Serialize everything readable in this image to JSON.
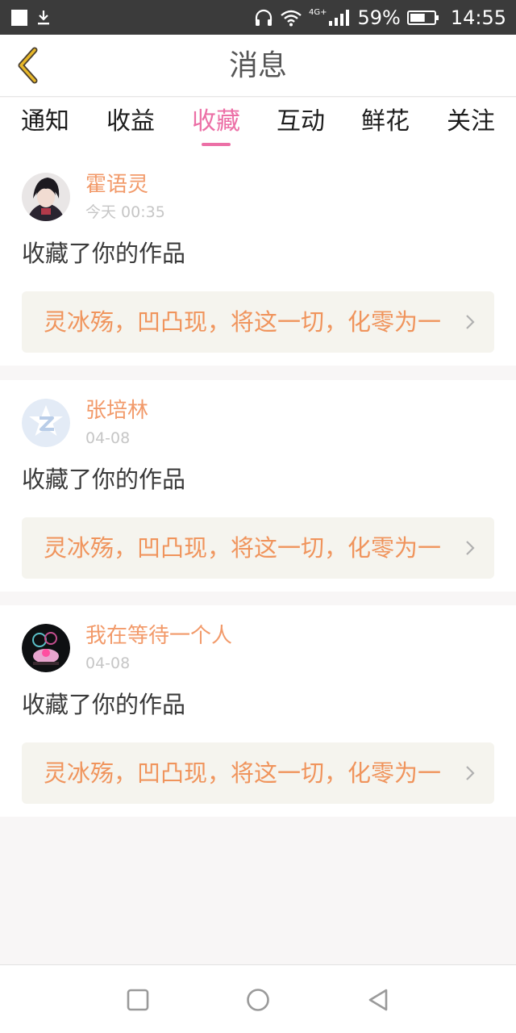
{
  "status_bar": {
    "network_type": "4G+",
    "battery_percent": "59%",
    "battery_level": 0.59,
    "time": "14:55"
  },
  "header": {
    "title": "消息",
    "back_icon": "chevron-left-icon"
  },
  "tabs": [
    {
      "label": "通知",
      "active": false
    },
    {
      "label": "收益",
      "active": false
    },
    {
      "label": "收藏",
      "active": true
    },
    {
      "label": "互动",
      "active": false
    },
    {
      "label": "鲜花",
      "active": false
    },
    {
      "label": "关注",
      "active": false
    }
  ],
  "messages": [
    {
      "username": "霍语灵",
      "time": "今天 00:35",
      "action": "收藏了你的作品",
      "work_title": "灵冰殇，凹凸现，将这一切，化零为一"
    },
    {
      "username": "张培林",
      "time": "04-08",
      "action": "收藏了你的作品",
      "work_title": "灵冰殇，凹凸现，将这一切，化零为一"
    },
    {
      "username": "我在等待一个人",
      "time": "04-08",
      "action": "收藏了你的作品",
      "work_title": "灵冰殇，凹凸现，将这一切，化零为一"
    }
  ],
  "colors": {
    "accent": "#ec6fa6",
    "username": "#f29a6a",
    "work_title": "#f0945c",
    "back_icon": "#e8b829"
  }
}
